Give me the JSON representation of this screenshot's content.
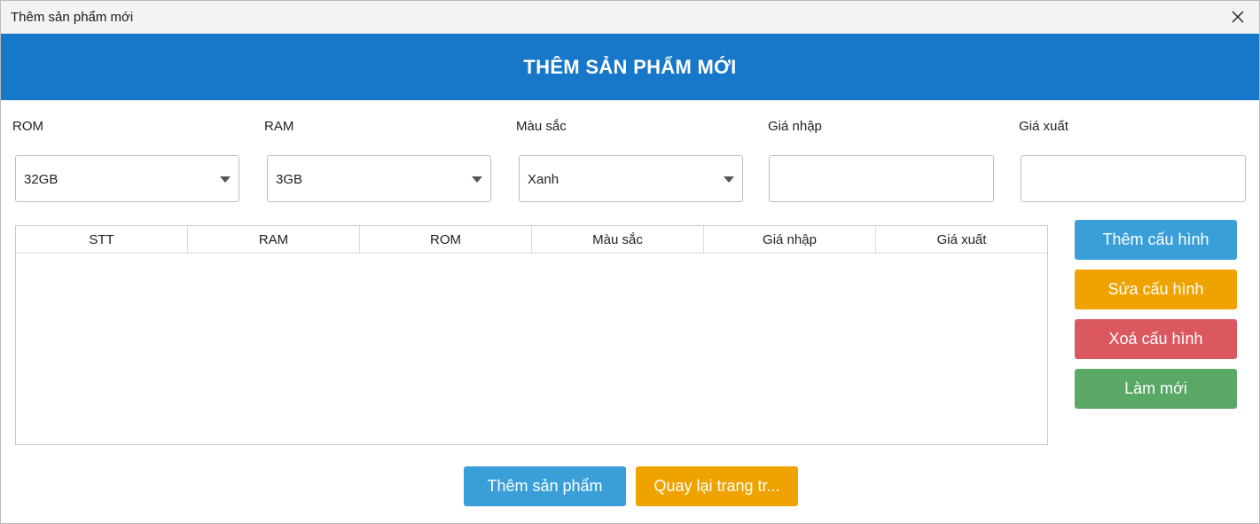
{
  "window": {
    "title": "Thêm sản phẩm mới"
  },
  "banner": {
    "title": "THÊM SẢN PHẨM MỚI"
  },
  "form": {
    "rom_label": "ROM",
    "rom_value": "32GB",
    "ram_label": "RAM",
    "ram_value": "3GB",
    "color_label": "Màu sắc",
    "color_value": "Xanh",
    "import_price_label": "Giá nhập",
    "import_price_value": "",
    "export_price_label": "Giá xuất",
    "export_price_value": ""
  },
  "table": {
    "columns": [
      "STT",
      "RAM",
      "ROM",
      "Màu sắc",
      "Giá nhập",
      "Giá xuất"
    ],
    "rows": []
  },
  "actions": {
    "add_config": "Thêm cấu hình",
    "edit_config": "Sửa cấu hình",
    "delete_config": "Xoá cấu hình",
    "refresh": "Làm mới",
    "add_product": "Thêm sản phẩm",
    "back": "Quay lại trang tr..."
  },
  "colors": {
    "banner": "#1777c9",
    "blue_button": "#3a9fd8",
    "orange_button": "#eea300",
    "red_button": "#dc5860",
    "green_button": "#59a866"
  },
  "icons": {
    "close": "close-icon",
    "dropdown": "chevron-down-icon"
  }
}
